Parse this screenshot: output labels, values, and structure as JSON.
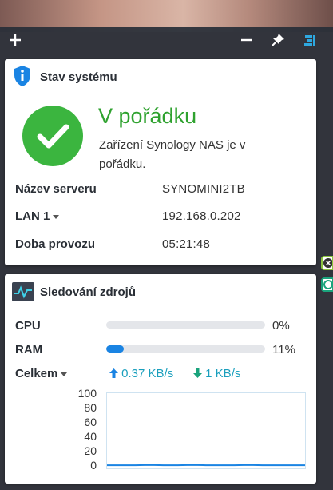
{
  "toolbar": {
    "add_icon": "plus-icon",
    "minimize_icon": "minus-icon",
    "pin_icon": "pin-icon",
    "layout_icon": "layout-icon"
  },
  "system_status": {
    "title": "Stav systému",
    "status_title": "V pořádku",
    "status_desc": "Zařízení Synology NAS je v pořádku.",
    "rows": [
      {
        "label": "Název serveru",
        "value": "SYNOMINI2TB"
      },
      {
        "label": "LAN 1",
        "value": "192.168.0.202"
      },
      {
        "label": "Doba provozu",
        "value": "05:21:48"
      }
    ],
    "colors": {
      "ok": "#3bb53f",
      "info": "#1a84e3"
    }
  },
  "resource_monitor": {
    "title": "Sledování zdrojů",
    "cpu": {
      "label": "CPU",
      "percent_text": "0%",
      "fraction": 0.0
    },
    "ram": {
      "label": "RAM",
      "percent_text": "11%",
      "fraction": 0.11
    },
    "network": {
      "label": "Celkem",
      "upload": "0.37 KB/s",
      "download": "1 KB/s"
    },
    "colors": {
      "bar": "#1a84e3",
      "net": "#1a9fbd"
    }
  },
  "chart_data": {
    "type": "line",
    "y_ticks": [
      "100",
      "80",
      "60",
      "40",
      "20",
      "0"
    ],
    "ylim": [
      0,
      100
    ],
    "series": [
      {
        "values": [
          1,
          1,
          1,
          1.5,
          1,
          1,
          1.5,
          1,
          1,
          1,
          1.5,
          1,
          1,
          1,
          1
        ]
      }
    ]
  }
}
